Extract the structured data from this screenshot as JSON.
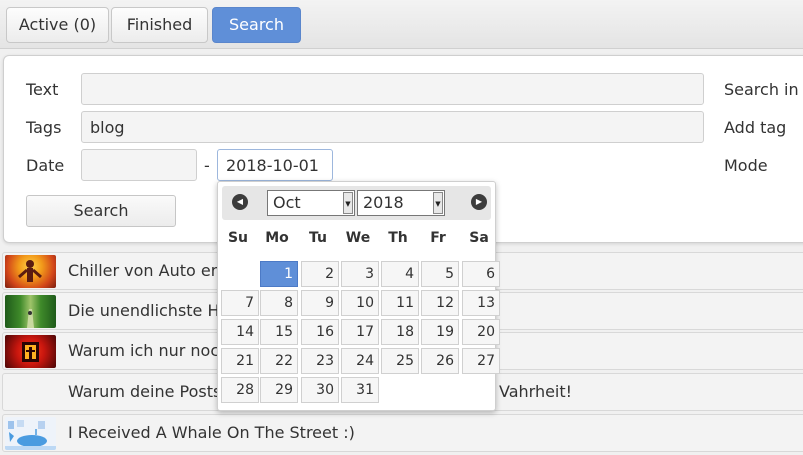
{
  "tabs": [
    {
      "label": "Active (0)"
    },
    {
      "label": "Finished"
    },
    {
      "label": "Search"
    }
  ],
  "search_form": {
    "text_label": "Text",
    "text_value": "",
    "tags_label": "Tags",
    "tags_value": "blog",
    "date_label": "Date",
    "date_from": "",
    "date_separator": "-",
    "date_to": "2018-10-01",
    "search_in_label": "Search in",
    "add_tag_label": "Add tag",
    "mode_label": "Mode",
    "search_button": "Search"
  },
  "results": [
    {
      "title": "Chiller von Auto erfa"
    },
    {
      "title": "Die unendlichste He"
    },
    {
      "title": "Warum ich nur noch"
    },
    {
      "title": "Warum deine Posts",
      "title_tail": "Vahrheit!"
    },
    {
      "title": "I Received A Whale On The Street :)"
    }
  ],
  "datepicker": {
    "month": "Oct",
    "year": "2018",
    "weekdays": [
      "Su",
      "Mo",
      "Tu",
      "We",
      "Th",
      "Fr",
      "Sa"
    ],
    "first_weekday_index": 1,
    "days_in_month": 31,
    "selected_day": 1,
    "accent_color": "#5f8fd8"
  }
}
